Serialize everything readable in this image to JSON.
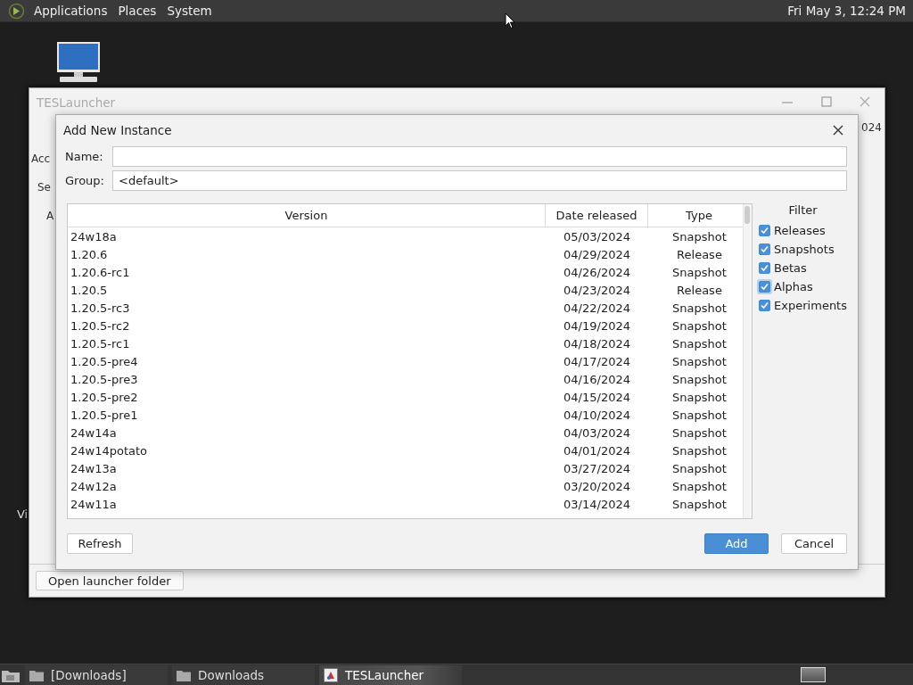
{
  "top_panel": {
    "menus": [
      "Applications",
      "Places",
      "System"
    ],
    "clock": "Fri May  3, 12:24 PM"
  },
  "desktop": {
    "partial_label": "Vi"
  },
  "background_window": {
    "title": "TESLauncher",
    "partial_labels": [
      "Acc",
      "Se",
      "A"
    ],
    "partial_text": "024",
    "button": "Open launcher folder"
  },
  "dialog": {
    "title": "Add New Instance",
    "fields": [
      {
        "label": "Name:"
      },
      {
        "label": "Group:",
        "value": "<default>"
      }
    ],
    "table": {
      "columns": [
        "Version",
        "Date released",
        "Type"
      ],
      "rows": [
        [
          "24w18a",
          "05/03/2024",
          "Snapshot"
        ],
        [
          "1.20.6",
          "04/29/2024",
          "Release"
        ],
        [
          "1.20.6-rc1",
          "04/26/2024",
          "Snapshot"
        ],
        [
          "1.20.5",
          "04/23/2024",
          "Release"
        ],
        [
          "1.20.5-rc3",
          "04/22/2024",
          "Snapshot"
        ],
        [
          "1.20.5-rc2",
          "04/19/2024",
          "Snapshot"
        ],
        [
          "1.20.5-rc1",
          "04/18/2024",
          "Snapshot"
        ],
        [
          "1.20.5-pre4",
          "04/17/2024",
          "Snapshot"
        ],
        [
          "1.20.5-pre3",
          "04/16/2024",
          "Snapshot"
        ],
        [
          "1.20.5-pre2",
          "04/15/2024",
          "Snapshot"
        ],
        [
          "1.20.5-pre1",
          "04/10/2024",
          "Snapshot"
        ],
        [
          "24w14a",
          "04/03/2024",
          "Snapshot"
        ],
        [
          "24w14potato",
          "04/01/2024",
          "Snapshot"
        ],
        [
          "24w13a",
          "03/27/2024",
          "Snapshot"
        ],
        [
          "24w12a",
          "03/20/2024",
          "Snapshot"
        ],
        [
          "24w11a",
          "03/14/2024",
          "Snapshot"
        ]
      ]
    },
    "filter": {
      "title": "Filter",
      "items": [
        {
          "label": "Releases",
          "checked": true,
          "focused": false
        },
        {
          "label": "Snapshots",
          "checked": true,
          "focused": false
        },
        {
          "label": "Betas",
          "checked": true,
          "focused": false
        },
        {
          "label": "Alphas",
          "checked": true,
          "focused": true
        },
        {
          "label": "Experiments",
          "checked": true,
          "focused": false
        }
      ]
    },
    "buttons": [
      {
        "label": "Refresh",
        "kind": "normal"
      },
      {
        "label": "Add",
        "kind": "default"
      },
      {
        "label": "Cancel",
        "kind": "normal"
      }
    ]
  },
  "taskbar": {
    "items": [
      {
        "label": "[Downloads]",
        "kind": "folder",
        "selected": false
      },
      {
        "label": "Downloads",
        "kind": "folder",
        "selected": false
      },
      {
        "label": "TESLauncher",
        "kind": "app",
        "selected": true
      }
    ]
  }
}
